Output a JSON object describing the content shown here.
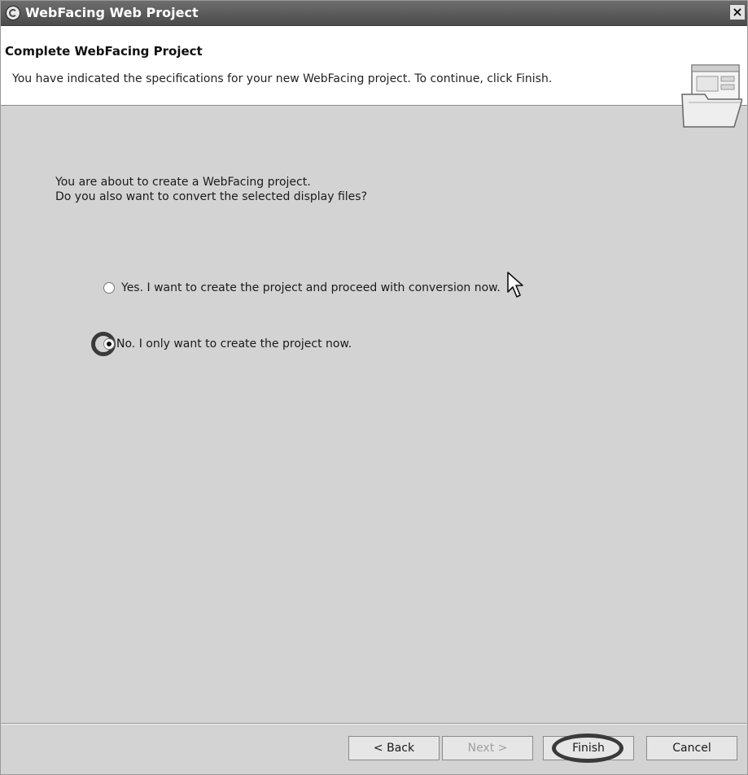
{
  "window": {
    "title": "WebFacing Web Project",
    "close_label": "×"
  },
  "header": {
    "title": "Complete WebFacing Project",
    "description": "You have indicated the specifications for your new WebFacing project. To continue, click Finish."
  },
  "content": {
    "question_line1": "You are about to create a WebFacing project.",
    "question_line2": "Do you also want to convert the selected display files?",
    "options": [
      {
        "label": "Yes. I want to create the project and proceed with conversion now.",
        "selected": false
      },
      {
        "label": "No. I only want to create the project now.",
        "selected": true
      }
    ]
  },
  "buttons": {
    "back": "< Back",
    "next": "Next >",
    "finish": "Finish",
    "cancel": "Cancel"
  },
  "icons": {
    "app": "webfacing-logo-icon",
    "wizard": "folder-wizard-icon",
    "cursor": "mouse-pointer-icon"
  }
}
